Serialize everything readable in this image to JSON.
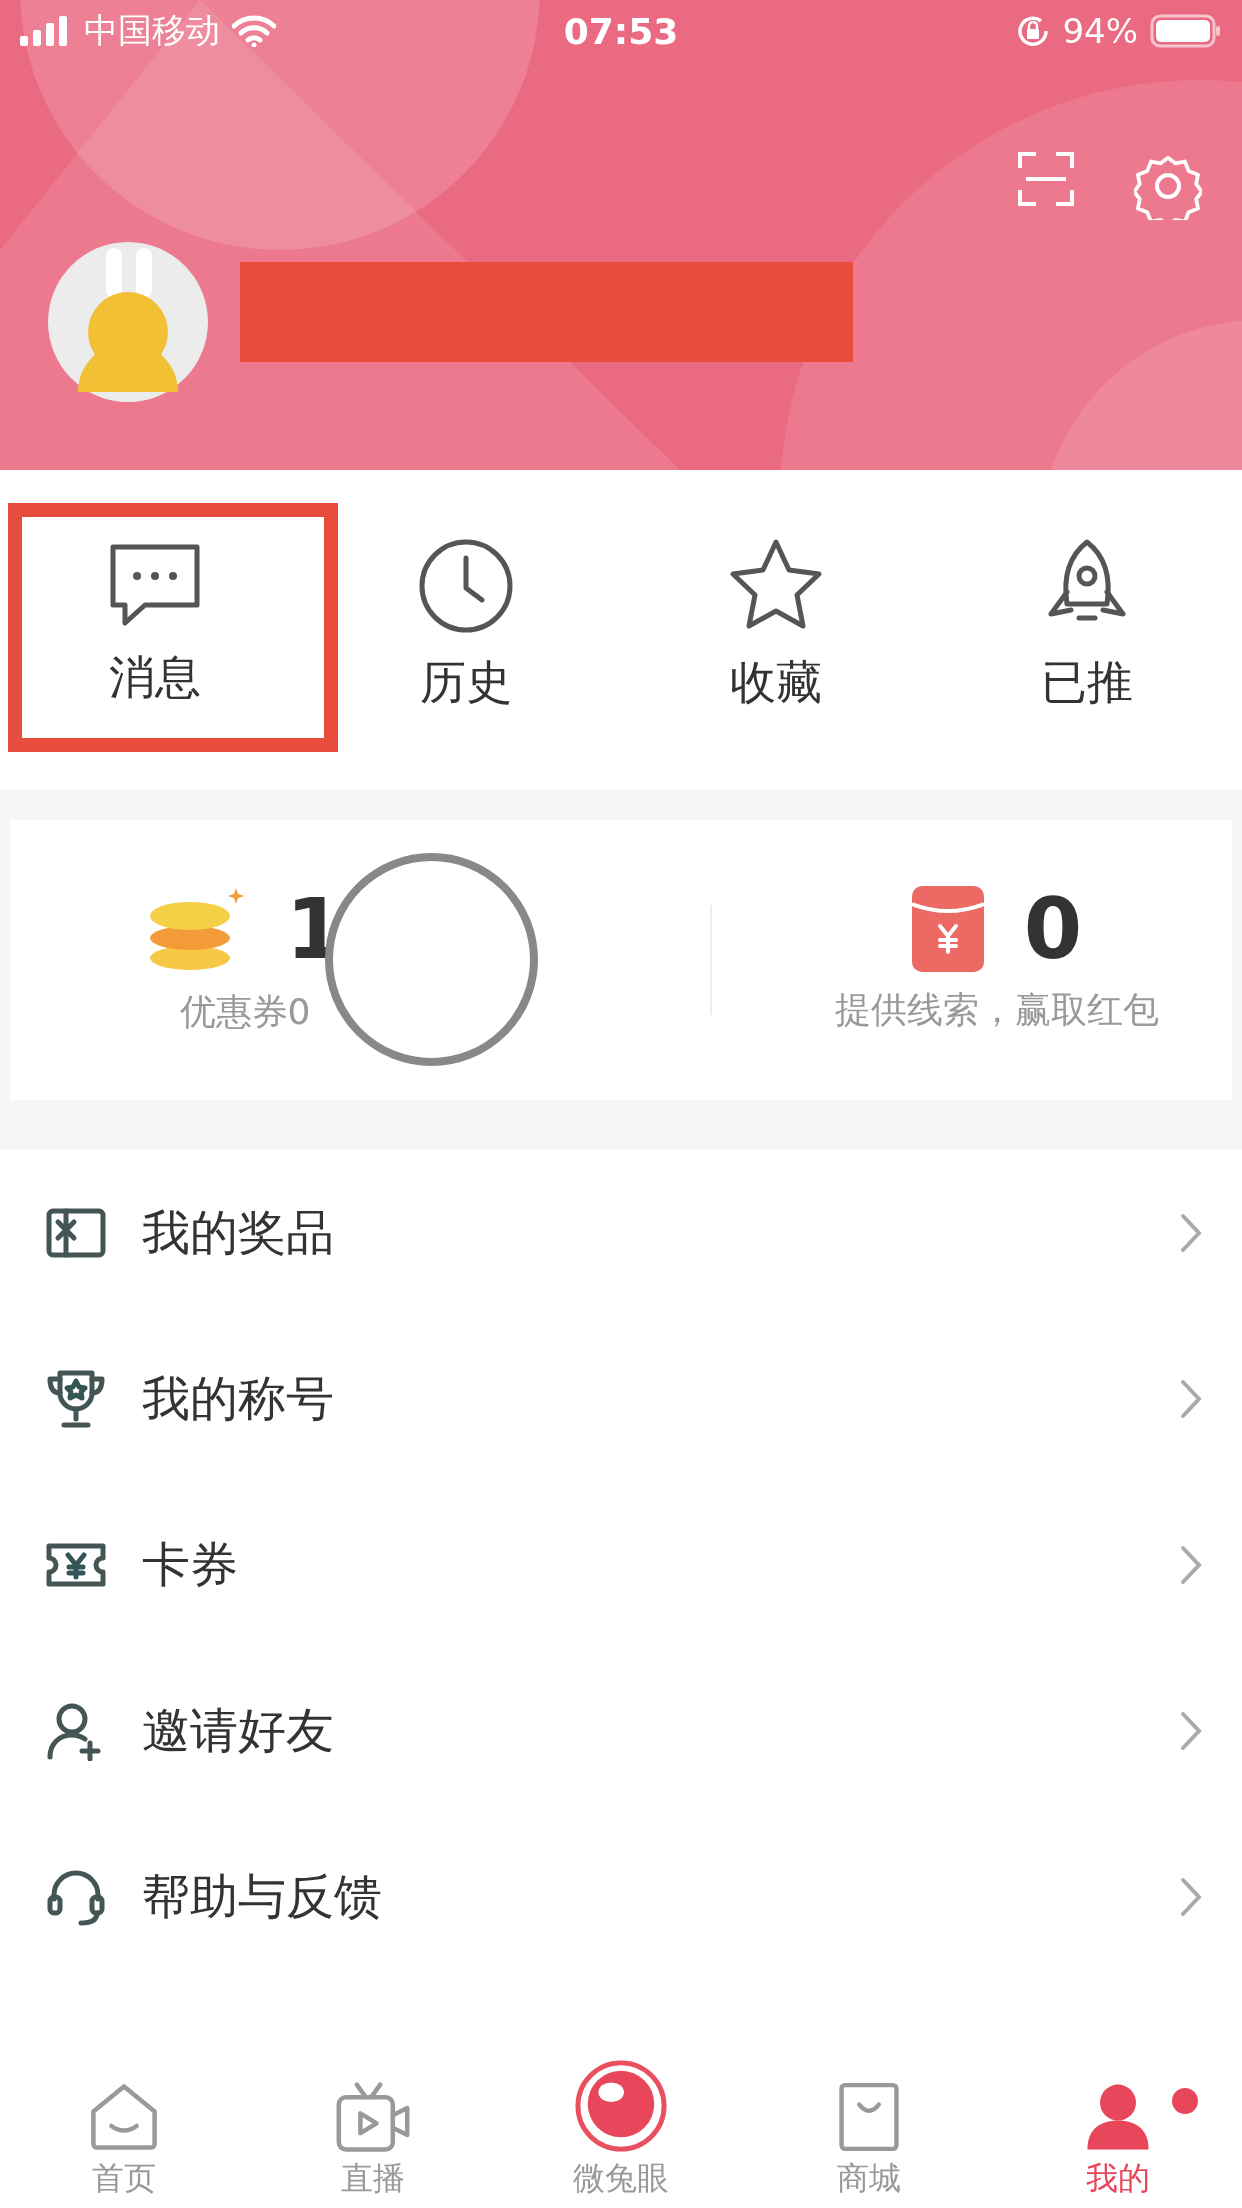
{
  "status_bar": {
    "carrier": "中国移动",
    "time": "07:53",
    "battery": "94%"
  },
  "header": {
    "redacted": true
  },
  "quick_actions": [
    {
      "label": "消息",
      "highlighted": true
    },
    {
      "label": "历史",
      "highlighted": false
    },
    {
      "label": "收藏",
      "highlighted": false
    },
    {
      "label": "已推",
      "highlighted": false
    }
  ],
  "stats": [
    {
      "value": "1",
      "label": "优惠券0"
    },
    {
      "value": "0",
      "label": "提供线索，赢取红包"
    }
  ],
  "menu": [
    {
      "label": "我的奖品"
    },
    {
      "label": "我的称号"
    },
    {
      "label": "卡券"
    },
    {
      "label": "邀请好友"
    },
    {
      "label": "帮助与反馈"
    }
  ],
  "tab_bar": [
    {
      "label": "首页",
      "selected": false,
      "badge": false
    },
    {
      "label": "直播",
      "selected": false,
      "badge": false
    },
    {
      "label": "微兔眼",
      "selected": false,
      "badge": false
    },
    {
      "label": "商城",
      "selected": false,
      "badge": false
    },
    {
      "label": "我的",
      "selected": true,
      "badge": true
    }
  ]
}
